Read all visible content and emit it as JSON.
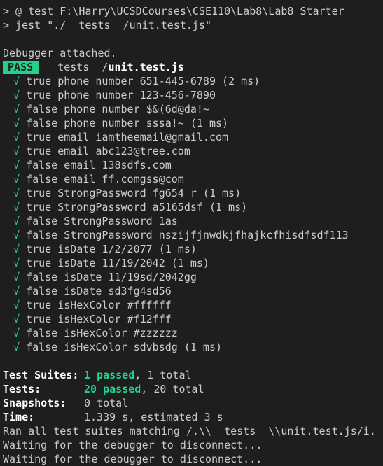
{
  "prompt": {
    "line1": "> @ test F:\\Harry\\UCSDCourses\\CSE110\\Lab8\\Lab8_Starter",
    "line2": "> jest \"./__tests__/unit.test.js\""
  },
  "debugger_attached": "Debugger attached.",
  "result": {
    "badge": "PASS",
    "path_dir": "__tests__/",
    "path_file": "unit.test.js"
  },
  "check_glyph": "√",
  "tests": [
    "true phone number 651-445-6789 (2 ms)",
    "true phone number 123-456-7890",
    "false phone number $&(6d@da!~",
    "false phone number sssa!~ (1 ms)",
    "true email iamtheemail@gmail.com",
    "true email abc123@tree.com",
    "false email 138sdfs.com",
    "false email ff.comgss@com",
    "true StrongPassword fg654_r (1 ms)",
    "true StrongPassword a5165dsf (1 ms)",
    "false StrongPassword 1as",
    "false StrongPassword nszijfjnwdkjfhajkcfhisdfsdf113",
    "true isDate 1/2/2077 (1 ms)",
    "true isDate 11/19/2042 (1 ms)",
    "false isDate 11/19sd/2042gg",
    "false isDate sd3fg4sd56",
    "true isHexColor #ffffff",
    "true isHexColor #f12fff",
    "false isHexColor #zzzzzz",
    "false isHexColor sdvbsdg (1 ms)"
  ],
  "summary": {
    "suites_label": "Test Suites:",
    "suites_passed": "1 passed",
    "suites_total": ", 1 total",
    "tests_label": "Tests:",
    "tests_passed": "20 passed",
    "tests_total": ", 20 total",
    "snapshots_label": "Snapshots:",
    "snapshots_value": "0 total",
    "time_label": "Time:",
    "time_value": "1.339 s, estimated 3 s"
  },
  "footer": {
    "ran": "Ran all test suites matching /.\\\\__tests__\\\\unit.test.js/i.",
    "waiting1": "Waiting for the debugger to disconnect...",
    "waiting2": "Waiting for the debugger to disconnect..."
  },
  "colors": {
    "background": "#1e1e1e",
    "text": "#cccccc",
    "pass_green": "#23d18b",
    "bold_white": "#ffffff"
  }
}
